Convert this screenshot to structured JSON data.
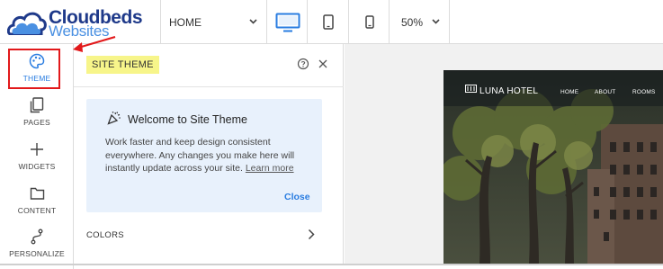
{
  "brand": {
    "line1": "Cloudbeds",
    "line2": "Websites"
  },
  "toolbar": {
    "page_select": "HOME",
    "devices": [
      {
        "name": "desktop-icon",
        "active": true
      },
      {
        "name": "tablet-icon",
        "active": false
      },
      {
        "name": "mobile-icon",
        "active": false
      }
    ],
    "zoom": "50%"
  },
  "sidebar": {
    "items": [
      {
        "label": "THEME",
        "icon": "palette-icon",
        "active": true
      },
      {
        "label": "PAGES",
        "icon": "pages-icon",
        "active": false
      },
      {
        "label": "WIDGETS",
        "icon": "plus-icon",
        "active": false
      },
      {
        "label": "CONTENT",
        "icon": "folder-icon",
        "active": false
      },
      {
        "label": "PERSONALIZE",
        "icon": "route-icon",
        "active": false
      }
    ]
  },
  "panel": {
    "title": "SITE THEME",
    "welcome": {
      "title": "Welcome to Site Theme",
      "body": "Work faster and keep design consistent everywhere. Any changes you make here will instantly update across your site.",
      "link": "Learn more",
      "close": "Close"
    },
    "sections": [
      {
        "label": "COLORS"
      }
    ]
  },
  "preview": {
    "hotel_name": "LUNA HOTEL",
    "nav": [
      "HOME",
      "ABOUT",
      "ROOMS"
    ]
  },
  "colors": {
    "accent": "#2a7de1",
    "highlight": "#f7f58a",
    "annotation_red": "#e2191b",
    "welcome_bg": "#e8f1fc"
  }
}
